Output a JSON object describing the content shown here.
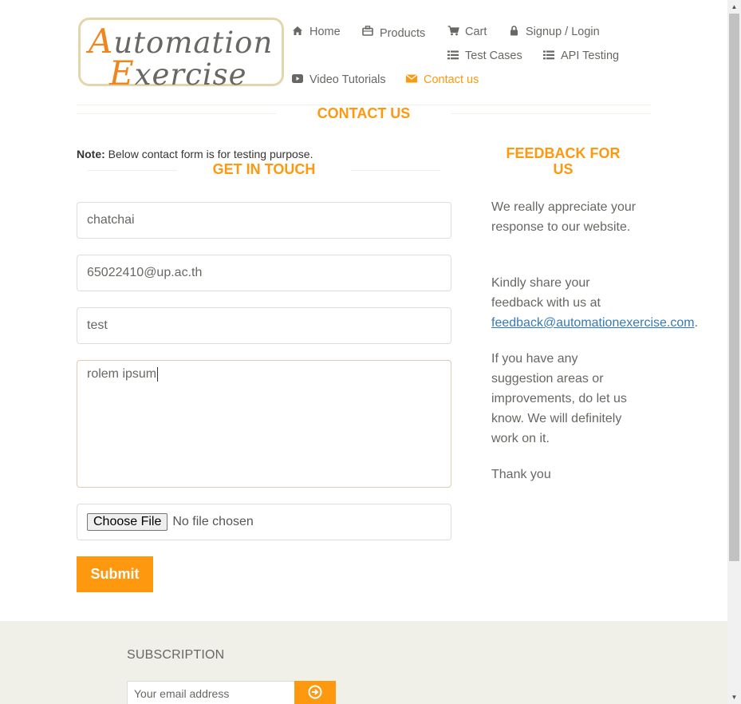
{
  "header": {
    "logo_line1_cap": "A",
    "logo_line1_rest": "utomation",
    "logo_line2_cap": "E",
    "logo_line2_rest": "xercise",
    "nav": {
      "home": "Home",
      "products": "Products",
      "cart": "Cart",
      "signup": "Signup / Login",
      "test_cases": "Test Cases",
      "api_testing": "API Testing",
      "video_tutorials": "Video Tutorials",
      "contact_us": "Contact us"
    }
  },
  "contact": {
    "title": "CONTACT US",
    "note_label": "Note:",
    "note_text": " Below contact form is for testing purpose.",
    "get_in_touch": "GET IN TOUCH",
    "name_value": "chatchai",
    "email_value": "65022410@up.ac.th",
    "subject_value": "test",
    "message_value": "rolem ipsum",
    "file_button": "Choose File",
    "file_status": "No file chosen",
    "submit": "Submit"
  },
  "feedback": {
    "title": "FEEDBACK FOR US",
    "para1": "We really appreciate your response to our website.",
    "para2_text": "Kindly share your feedback with us at ",
    "para2_link": "feedback@automationexercise.com",
    "para2_end": ".",
    "para3": "If you have any suggestion areas or improvements, do let us know. We will definitely work on it.",
    "para4": "Thank you"
  },
  "footer": {
    "subscription_title": "SUBSCRIPTION",
    "email_placeholder": "Your email address"
  },
  "colors": {
    "accent": "#fe980f",
    "text": "#696763",
    "link": "#337ab7",
    "footer_bg": "#f0f0e9"
  },
  "icons": {
    "home": "home-icon",
    "products": "briefcase-icon",
    "cart": "cart-icon",
    "signup": "lock-icon",
    "test_cases": "list-icon",
    "api_testing": "list-icon",
    "video": "youtube-play-icon",
    "contact": "envelope-icon",
    "subscribe": "circle-arrow-right-icon"
  }
}
